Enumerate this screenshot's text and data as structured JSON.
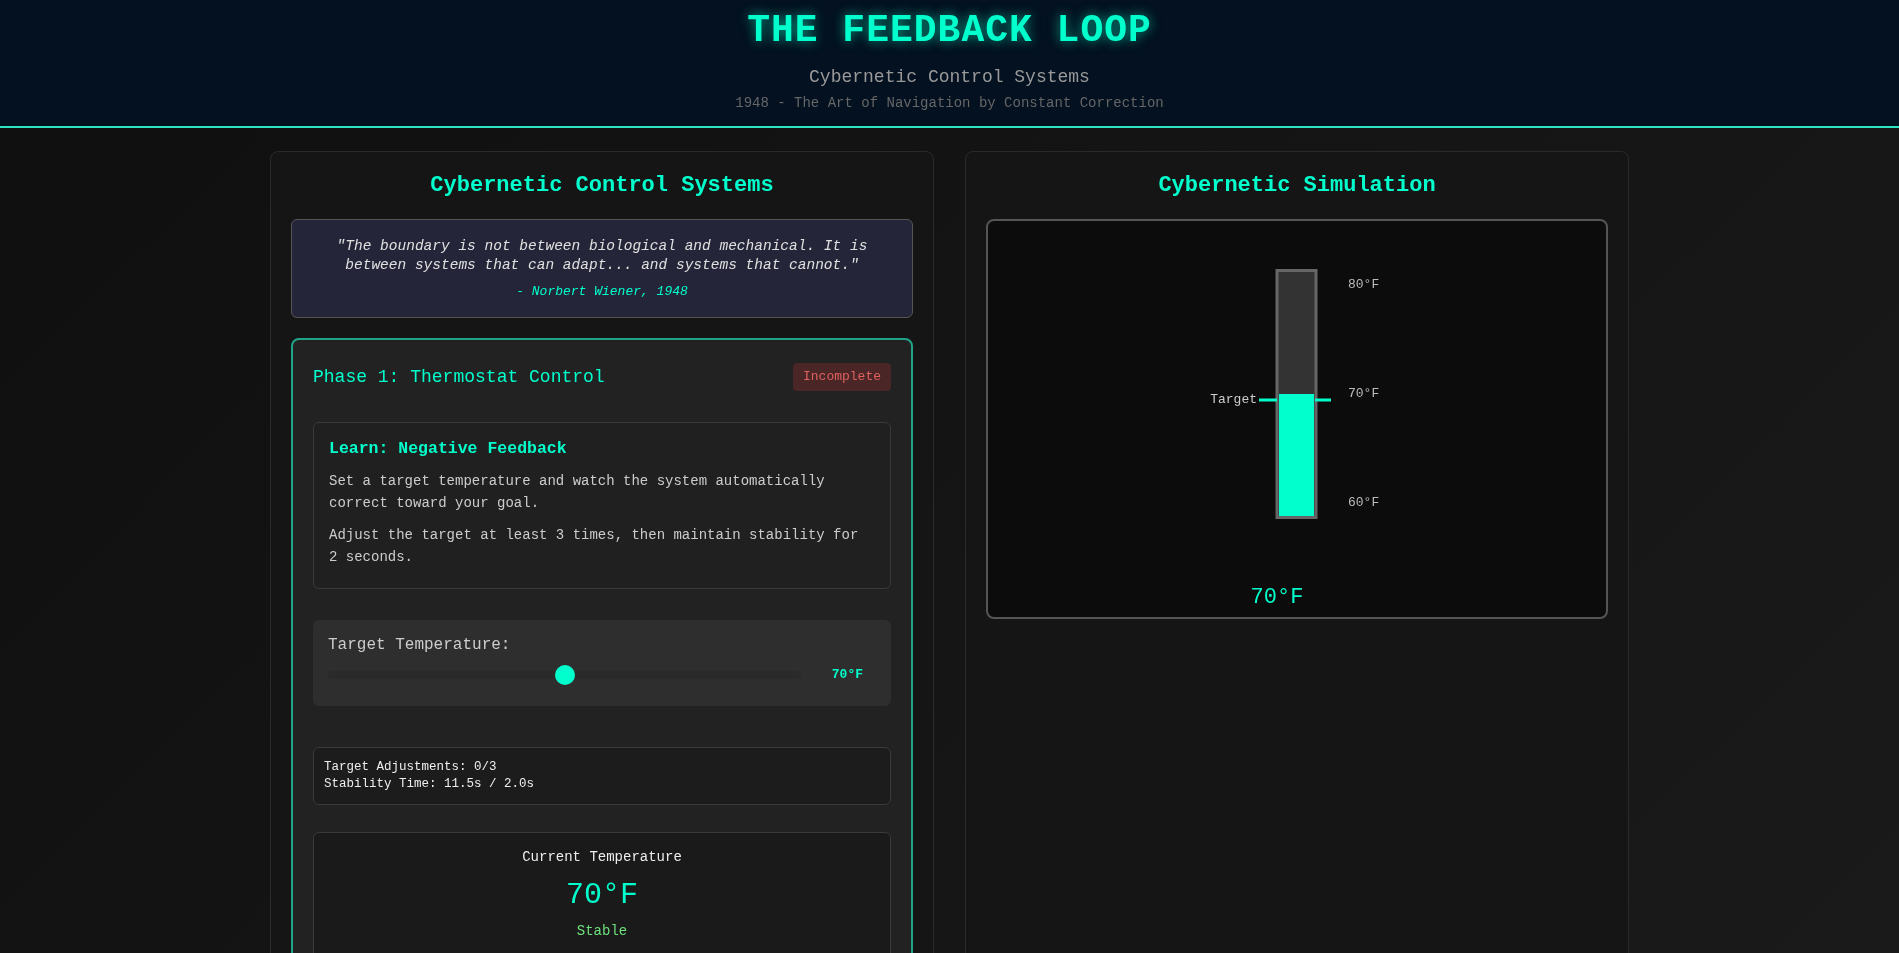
{
  "header": {
    "title": "THE FEEDBACK LOOP",
    "subtitle": "Cybernetic Control Systems",
    "tagline": "1948 - The Art of Navigation by Constant Correction"
  },
  "control_panel": {
    "title": "Cybernetic Control Systems",
    "quote": {
      "text": "\"The boundary is not between biological and mechanical. It is between systems that can adapt... and systems that cannot.\"",
      "attribution": "- Norbert Wiener, 1948"
    },
    "phase": {
      "title": "Phase 1: Thermostat Control",
      "status": "Incomplete",
      "completed": false,
      "lesson": {
        "title": "Learn: Negative Feedback",
        "paragraphs": [
          "Set a target temperature and watch the system automatically correct toward your goal.",
          "Adjust the target at least 3 times, then maintain stability for 2 seconds."
        ]
      },
      "slider": {
        "label": "Target Temperature:",
        "level": 0.5,
        "value": "70°F"
      },
      "progress": [
        "Target Adjustments: 0/3",
        "Stability Time: 11.5s / 2.0s"
      ],
      "current": {
        "label": "Current Temperature",
        "value": "70°F",
        "status": "Stable",
        "stable": true
      }
    }
  },
  "simulation": {
    "title": "Cybernetic Simulation",
    "thermometer": {
      "level": 0.5,
      "scale": [
        "80°F",
        "70°F",
        "60°F"
      ],
      "target_label": "Target",
      "reading": "70°F"
    }
  }
}
